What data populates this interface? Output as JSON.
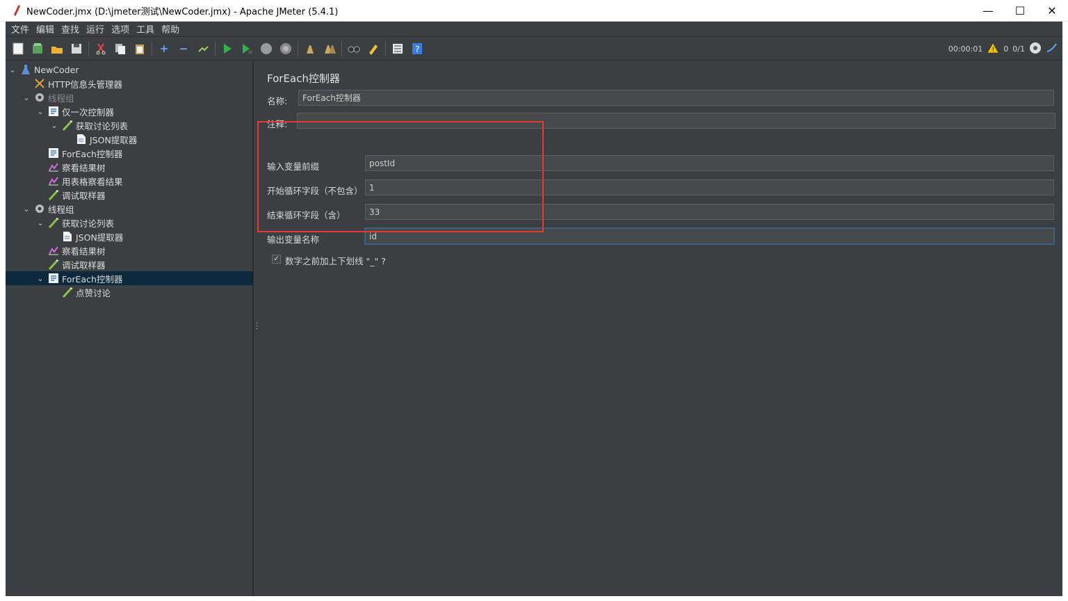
{
  "window": {
    "title": "NewCoder.jmx (D:\\jmeter测试\\NewCoder.jmx) - Apache JMeter (5.4.1)",
    "minimize": "—",
    "maximize": "☐",
    "close": "✕"
  },
  "menu": [
    "文件",
    "编辑",
    "查找",
    "运行",
    "选项",
    "工具",
    "帮助"
  ],
  "toolbar": {
    "timer": "00:00:01",
    "warnings": "0",
    "threads": "0/1"
  },
  "tree": [
    {
      "label": "NewCoder",
      "icon": "flask-icon",
      "depth": 0,
      "expanded": true
    },
    {
      "label": "HTTP信息头管理器",
      "icon": "tools-icon",
      "depth": 1
    },
    {
      "label": "线程组",
      "icon": "gear-icon",
      "depth": 1,
      "expanded": true,
      "disabled": true
    },
    {
      "label": "仅一次控制器",
      "icon": "controller-icon",
      "depth": 2,
      "expanded": true
    },
    {
      "label": "获取讨论列表",
      "icon": "sampler-icon",
      "depth": 3,
      "expanded": true
    },
    {
      "label": "JSON提取器",
      "icon": "document-icon",
      "depth": 4
    },
    {
      "label": "ForEach控制器",
      "icon": "controller-icon",
      "depth": 2
    },
    {
      "label": "察看结果树",
      "icon": "chart-icon",
      "depth": 2
    },
    {
      "label": "用表格察看结果",
      "icon": "chart-icon",
      "depth": 2
    },
    {
      "label": "调试取样器",
      "icon": "sampler-icon",
      "depth": 2
    },
    {
      "label": "线程组",
      "icon": "gear-icon",
      "depth": 1,
      "expanded": true
    },
    {
      "label": "获取讨论列表",
      "icon": "sampler-icon",
      "depth": 2,
      "expanded": true
    },
    {
      "label": "JSON提取器",
      "icon": "document-icon",
      "depth": 3
    },
    {
      "label": "察看结果树",
      "icon": "chart-icon",
      "depth": 2
    },
    {
      "label": "调试取样器",
      "icon": "sampler-icon",
      "depth": 2
    },
    {
      "label": "ForEach控制器",
      "icon": "controller-icon",
      "depth": 2,
      "expanded": true,
      "selected": true
    },
    {
      "label": "点赞讨论",
      "icon": "sampler-icon",
      "depth": 3
    }
  ],
  "panel": {
    "title": "ForEach控制器",
    "name_label": "名称:",
    "name_value": "ForEach控制器",
    "comment_label": "注释:",
    "comment_value": "",
    "input_prefix_label": "输入变量前缀",
    "input_prefix_value": "postId",
    "start_label": "开始循环字段（不包含）",
    "start_value": "1",
    "end_label": "结束循环字段（含）",
    "end_value": "33",
    "output_label": "输出变量名称",
    "output_value": "id",
    "underscore_label": "数字之前加上下划线 \"_\" ?"
  },
  "colors": {
    "background": "#3c3f41",
    "selection": "#0d293e",
    "highlight_box": "#e53935"
  }
}
